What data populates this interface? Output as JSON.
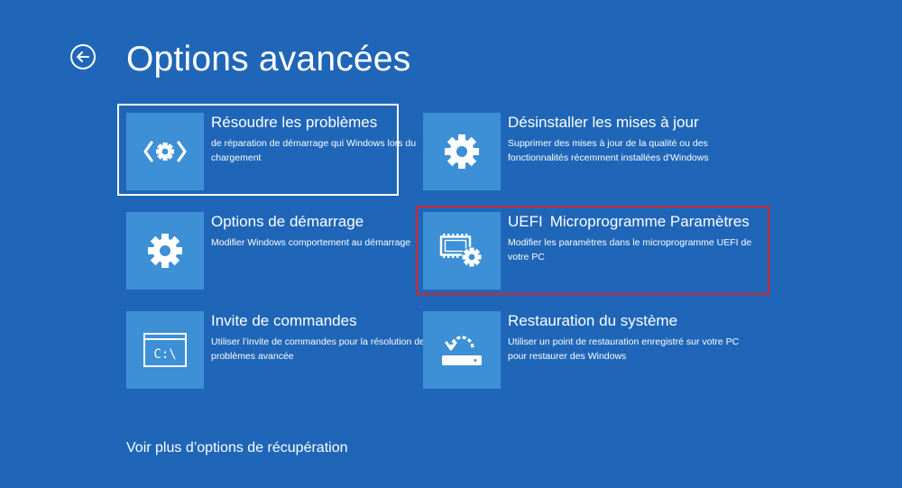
{
  "page": {
    "title": "Options avancées",
    "back_icon": "back-arrow-icon",
    "more_options": "Voir plus d’options de récupération"
  },
  "colors": {
    "background": "#1f66b8",
    "tile": "#3d8fd6",
    "text": "#ffffff",
    "highlight": "#d9242a"
  },
  "options": [
    {
      "title": "Résoudre les problèmes",
      "description": "de réparation de démarrage qui Windows lors du chargement",
      "icon": "code-gear-icon",
      "focused": true
    },
    {
      "title": "Désinstaller les mises à jour",
      "description": "Supprimer des mises à jour de la qualité ou des fonctionnalités récemment installées d'Windows",
      "icon": "gear-icon"
    },
    {
      "title": "Options de démarrage",
      "description": "Modifier Windows comportement au démarrage",
      "icon": "gear-icon"
    },
    {
      "title_prefix": "UEFI",
      "title": "Microprogramme Paramètres",
      "description": "Modifier les paramètres dans le microprogramme UEFI de votre PC",
      "icon": "chip-gear-icon",
      "highlighted": true
    },
    {
      "title": "Invite de commandes",
      "description": "Utiliser l’invite de commandes pour la résolution des problèmes avancée",
      "icon": "command-prompt-icon",
      "icon_text": "C:\\"
    },
    {
      "title": "Restauration du système",
      "description": "Utiliser un point de restauration enregistré sur votre PC pour restaurer des Windows",
      "icon": "system-restore-icon"
    }
  ]
}
